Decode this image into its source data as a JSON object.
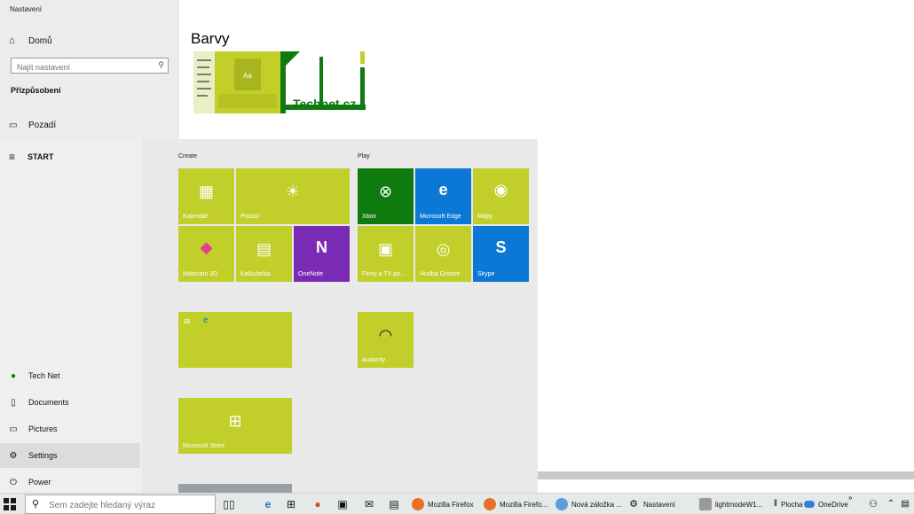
{
  "settings": {
    "window_title": "Nastavení",
    "home_label": "Domů",
    "search_placeholder": "Najít nastavení",
    "section_title": "Přizpůsobení",
    "background_label": "Pozadí",
    "page_heading": "Barvy",
    "preview_logo": "Technet.cz"
  },
  "start_menu": {
    "header": "START",
    "left_items": [
      {
        "label": "Tech Net",
        "icon": "user-icon"
      },
      {
        "label": "Documents",
        "icon": "document-icon"
      },
      {
        "label": "Pictures",
        "icon": "pictures-icon"
      },
      {
        "label": "Settings",
        "icon": "gear-icon"
      },
      {
        "label": "Power",
        "icon": "power-icon"
      }
    ],
    "groups": {
      "create": "Create",
      "play": "Play"
    },
    "tiles": {
      "calendar": "Kalendář",
      "weather": "Počasí",
      "xbox": "Xbox",
      "edge": "Microsoft Edge",
      "maps": "Mapy",
      "paint3d": "Malování 3D",
      "calculator": "Kalkulačka",
      "onenote": "OneNote",
      "films": "Filmy a TV po...",
      "groove": "Hudba Groove",
      "skype": "Skype",
      "mail": "",
      "audacity": "audacity",
      "store": "Microsoft Store"
    }
  },
  "taskbar": {
    "search_placeholder": "Sem zadejte hledaný výraz",
    "items": [
      "Mozilla Firefox",
      "Mozilla Firefo...",
      "Nová záložka ...",
      "Nastavení",
      "lightmodeW1...",
      "Plocha",
      "OneDrive"
    ],
    "overflow": "»"
  },
  "colors": {
    "accent_lime": "#c2cf2a",
    "xbox_green": "#0f7b0f",
    "edge_blue": "#0a78d4",
    "onenote_purple": "#7a2bb5"
  }
}
